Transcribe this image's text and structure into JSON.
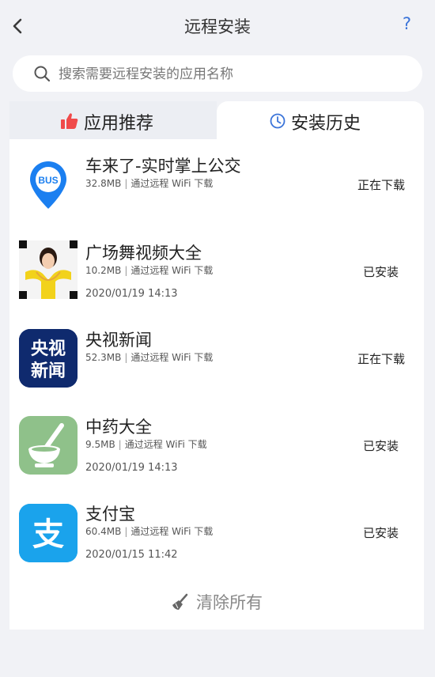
{
  "header": {
    "title": "远程安装",
    "help_label": "?"
  },
  "search": {
    "placeholder": "搜索需要远程安装的应用名称"
  },
  "tabs": [
    {
      "label": "应用推荐"
    },
    {
      "label": "安装历史"
    }
  ],
  "apps": [
    {
      "name": "车来了-实时掌上公交",
      "size": "32.8MB",
      "source": "通过远程 WiFi 下载",
      "date": "",
      "status": "正在下载",
      "icon_label": "BUS",
      "icon": "bus-pin-icon"
    },
    {
      "name": "广场舞视频大全",
      "size": "10.2MB",
      "source": "通过远程 WiFi 下载",
      "date": "2020/01/19 14:13",
      "status": "已安装",
      "icon": "dancer-photo-icon"
    },
    {
      "name": "央视新闻",
      "size": "52.3MB",
      "source": "通过远程 WiFi 下载",
      "date": "",
      "status": "正在下载",
      "icon_text1": "央视",
      "icon_text2": "新闻",
      "icon": "cctv-news-icon"
    },
    {
      "name": "中药大全",
      "size": "9.5MB",
      "source": "通过远程 WiFi 下载",
      "date": "2020/01/19 14:13",
      "status": "已安装",
      "icon": "mortar-pestle-icon"
    },
    {
      "name": "支付宝",
      "size": "60.4MB",
      "source": "通过远程 WiFi 下载",
      "date": "2020/01/15 11:42",
      "status": "已安装",
      "icon_text": "支",
      "icon": "alipay-icon"
    }
  ],
  "clear_all": {
    "label": "清除所有"
  },
  "colors": {
    "accent_blue": "#1b7ff0",
    "help_blue": "#3b74d9",
    "thumb_red": "#f04a4a",
    "cctv_navy": "#0f2a6e",
    "herb_green": "#8fc18a",
    "alipay_blue": "#1aa3ec"
  }
}
